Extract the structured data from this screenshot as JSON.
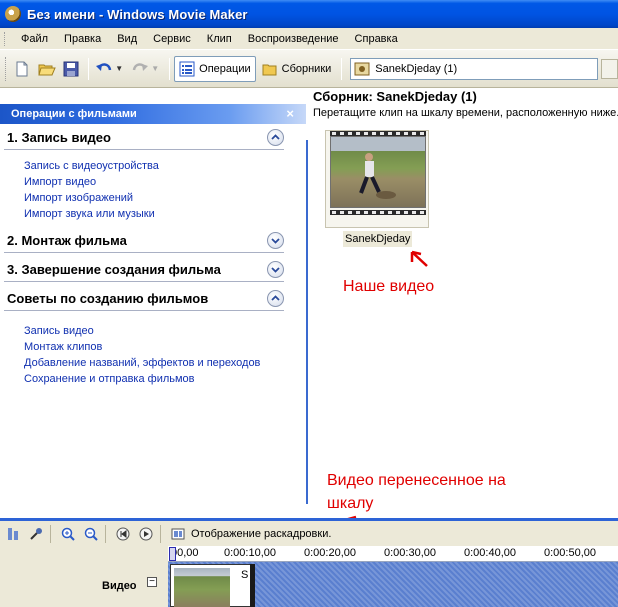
{
  "window": {
    "title": "Без имени - Windows Movie Maker"
  },
  "menu": [
    "Файл",
    "Правка",
    "Вид",
    "Сервис",
    "Клип",
    "Воспроизведение",
    "Справка"
  ],
  "toolbar": {
    "operations_label": "Операции",
    "collections_label": "Сборники",
    "collection_value": "SanekDjeday (1)"
  },
  "tasks": {
    "header": "Операции с фильмами",
    "close_glyph": "×",
    "sections": [
      {
        "title": "1. Запись видео",
        "expanded": true,
        "links": [
          "Запись с видеоустройства",
          "Импорт видео",
          "Импорт изображений",
          "Импорт звука или музыки"
        ]
      },
      {
        "title": "2. Монтаж фильма",
        "expanded": false,
        "links": []
      },
      {
        "title": "3. Завершение создания фильма",
        "expanded": false,
        "links": []
      },
      {
        "title": "Советы по созданию фильмов",
        "expanded": true,
        "links": [
          "Запись видео",
          "Монтаж клипов",
          "Добавление названий, эффектов и переходов",
          "Сохранение и отправка фильмов"
        ]
      }
    ]
  },
  "collection": {
    "title": "Сборник: SanekDjeday (1)",
    "hint": "Перетащите клип на шкалу времени, расположенную ниже.",
    "clip_name": "SanekDjeday"
  },
  "annotations": {
    "our_video": "Наше видео",
    "moved_video_line1": "Видео перенесенное на",
    "moved_video_line2": "шкалу"
  },
  "timeline": {
    "storyboard_label": "Отображение раскадровки.",
    "ruler_ticks": [
      "00,00",
      "0:00:10,00",
      "0:00:20,00",
      "0:00:30,00",
      "0:00:40,00",
      "0:00:50,00"
    ],
    "video_track_label": "Видео",
    "collapse_glyph": "−",
    "clip_letter": "S"
  },
  "colors": {
    "title_bar": "#0054e3",
    "tasks_header": "#2e6be0",
    "link": "#1030b0",
    "annotation": "#e00000",
    "timeline_border": "#2d63d6"
  }
}
